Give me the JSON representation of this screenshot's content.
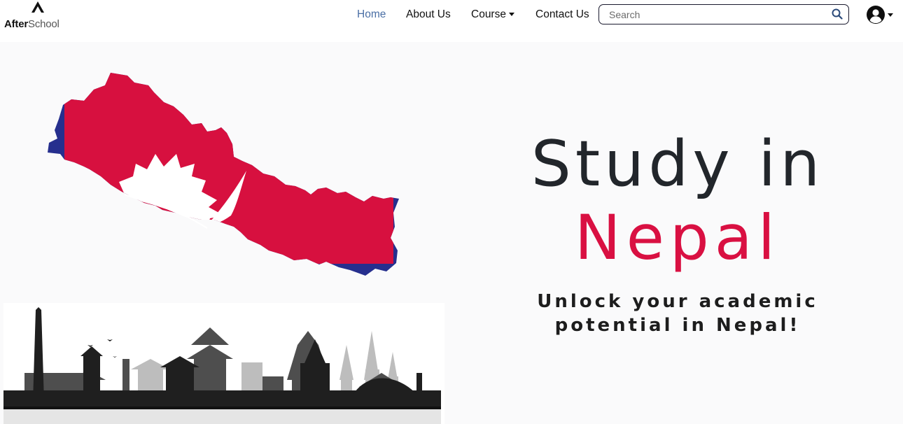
{
  "brand": {
    "name_part1": "After",
    "name_part2": "School",
    "logo_icon": "triangle-mountain-logo"
  },
  "nav": {
    "items": [
      {
        "label": "Home",
        "active": true
      },
      {
        "label": "About Us",
        "active": false
      },
      {
        "label": "Course",
        "active": false,
        "has_dropdown": true
      },
      {
        "label": "Contact Us",
        "active": false
      }
    ]
  },
  "search": {
    "placeholder": "Search",
    "value": "",
    "icon": "search-icon"
  },
  "user": {
    "icon": "user-circle-icon",
    "has_dropdown": true
  },
  "hero": {
    "title_line1": "Study in",
    "title_line2": "Nepal",
    "tagline": "Unlock your academic potential in Nepal!",
    "map_image": "nepal-flag-map",
    "skyline_image": "kathmandu-skyline"
  },
  "colors": {
    "accent_red": "#d91042",
    "flag_red": "#d7103f",
    "flag_blue": "#262f8e",
    "nav_active": "#4a6fa5",
    "text_dark": "#22262b"
  }
}
